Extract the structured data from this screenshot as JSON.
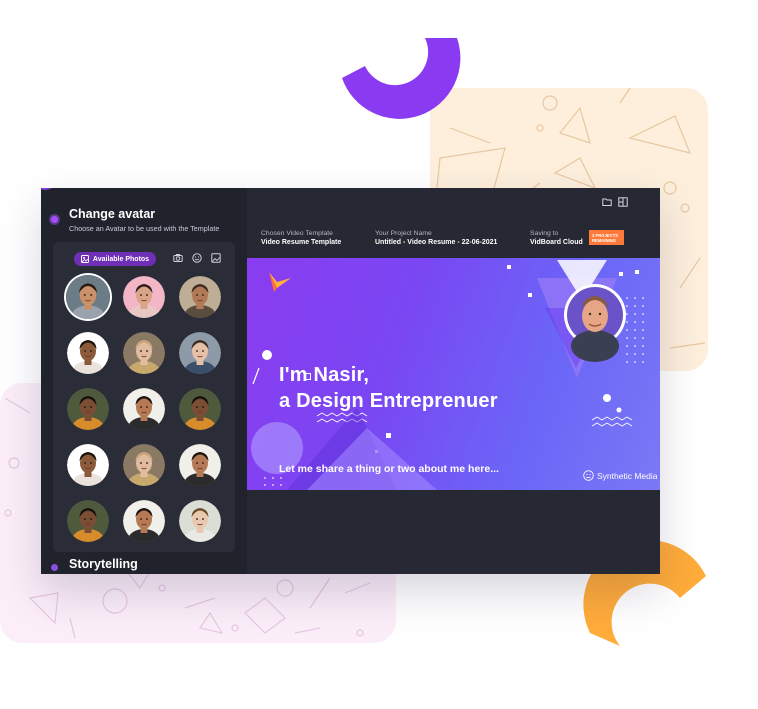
{
  "sidebar": {
    "change_avatar": {
      "title": "Change avatar",
      "subtitle": "Choose an Avatar to be used with the Template"
    },
    "available_photos_label": "Available Photos",
    "tool_icons": [
      "camera-icon",
      "emoji-icon",
      "image-icon"
    ],
    "avatars": [
      {
        "skin": "#c9916a",
        "hair": "#2a1a12",
        "shirt": "#9aa3ad",
        "bg": "#6b7c86"
      },
      {
        "skin": "#d9a489",
        "hair": "#2b1d18",
        "shirt": "#e8c8c3",
        "bg": "#f2b6c7"
      },
      {
        "skin": "#b07a57",
        "hair": "#3a2a20",
        "shirt": "#5b4d3d",
        "bg": "#c0ad95"
      },
      {
        "skin": "#8a5a3a",
        "hair": "#1a120d",
        "shirt": "#e9e3dc",
        "bg": "#ffffff"
      },
      {
        "skin": "#e0bba0",
        "hair": "#c9a77a",
        "shirt": "#c7a86d",
        "bg": "#8a7a64"
      },
      {
        "skin": "#e5c0a7",
        "hair": "#3a2a20",
        "shirt": "#3b4e6b",
        "bg": "#8d9aa8"
      },
      {
        "skin": "#7a4e34",
        "hair": "#16100c",
        "shirt": "#d88b2a",
        "bg": "#4f5a3d"
      },
      {
        "skin": "#b57a55",
        "hair": "#1e140e",
        "shirt": "#2b2b2b",
        "bg": "#f1efe9"
      },
      {
        "skin": "#7a4e34",
        "hair": "#16100c",
        "shirt": "#d88b2a",
        "bg": "#4f5a3d"
      },
      {
        "skin": "#8a5a3a",
        "hair": "#1a120d",
        "shirt": "#e9e3dc",
        "bg": "#ffffff"
      },
      {
        "skin": "#e0bba0",
        "hair": "#c9a77a",
        "shirt": "#c7a86d",
        "bg": "#8a7a64"
      },
      {
        "skin": "#b57a55",
        "hair": "#1e140e",
        "shirt": "#2b2b2b",
        "bg": "#f1efe9"
      },
      {
        "skin": "#7a4e34",
        "hair": "#16100c",
        "shirt": "#d88b2a",
        "bg": "#4f5a3d"
      },
      {
        "skin": "#b57a55",
        "hair": "#1e140e",
        "shirt": "#2b2b2b",
        "bg": "#f1efe9"
      },
      {
        "skin": "#e8c9b0",
        "hair": "#6b4a2a",
        "shirt": "#e9e9e6",
        "bg": "#d9dfd4"
      }
    ],
    "storytelling": {
      "title": "Storytelling"
    }
  },
  "topbar": {
    "icons": [
      "folder-icon",
      "export-icon"
    ],
    "template_label": "Chosen Video Template",
    "template_value": "Video Resume Template",
    "project_label": "Your Project Name",
    "project_value": "Untitled - Video Resume - 22-06-2021",
    "saving_label": "Saving to",
    "saving_value": "VidBoard Cloud",
    "badge_line1": "3 PROJECTS",
    "badge_line2": "REMAINING"
  },
  "preview": {
    "headline_1": "I'm Nasir,",
    "headline_2": "a Design Entreprenuer",
    "tagline": "Let me share a thing or two about me here...",
    "brand": "Synthetic Media"
  },
  "colors": {
    "accent_purple": "#8a3cf0",
    "badge_orange": "#ff7a3a",
    "window_dark": "#262833",
    "sidebar_dark": "#20222c"
  }
}
